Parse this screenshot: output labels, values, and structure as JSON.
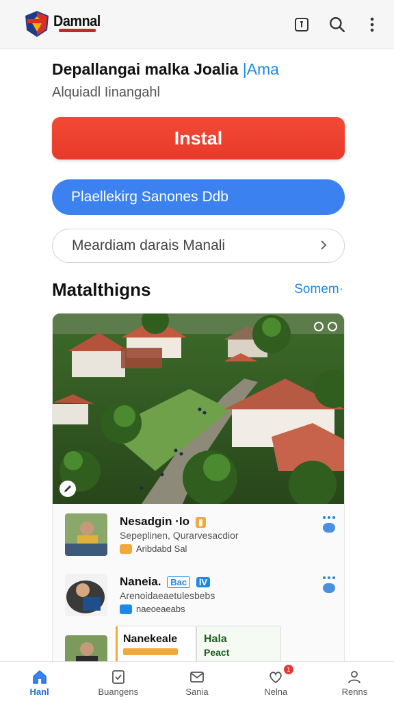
{
  "appbar": {
    "brand": "Damnal",
    "icons": [
      "square-arrow-icon",
      "search-icon",
      "more-vert-icon"
    ]
  },
  "header": {
    "title": "Depallangai malka Joalia",
    "title_accent": "|Ama",
    "subtitle": "Alquiadl Iinangahl"
  },
  "actions": {
    "install_label": "Instal",
    "primary_label": "Plaellekirg Sanones Ddb",
    "secondary_label": "Meardiam darais Manali"
  },
  "section": {
    "title": "Matalthigns",
    "link": "Somem"
  },
  "list": [
    {
      "title": "Nesadgin",
      "title_suffix": "·lo",
      "subtitle": "Sepeplinen, Qurarvesacdior",
      "meta": "Aribdabd Sal"
    },
    {
      "title": "Naneia.",
      "title_suffix": "Bac",
      "title_suffix2": "lV",
      "subtitle": "Arenoidaeaetulesbebs",
      "meta": "naeoeaeabs"
    },
    {
      "title": "Nanekeale",
      "subtitle": "",
      "card_title": "Hala",
      "card_sub": "Peact"
    }
  ],
  "bottom_nav": {
    "items": [
      {
        "label": "Hanl",
        "icon": "home-icon"
      },
      {
        "label": "Buangens",
        "icon": "checklist-icon"
      },
      {
        "label": "Sania",
        "icon": "mail-icon"
      },
      {
        "label": "Nelna",
        "icon": "heart-icon",
        "badge": "1"
      },
      {
        "label": "Renns",
        "icon": "person-icon"
      }
    ]
  },
  "colors": {
    "install": "#e8392a",
    "primary": "#3b82f0",
    "accent": "#1e88e5"
  }
}
